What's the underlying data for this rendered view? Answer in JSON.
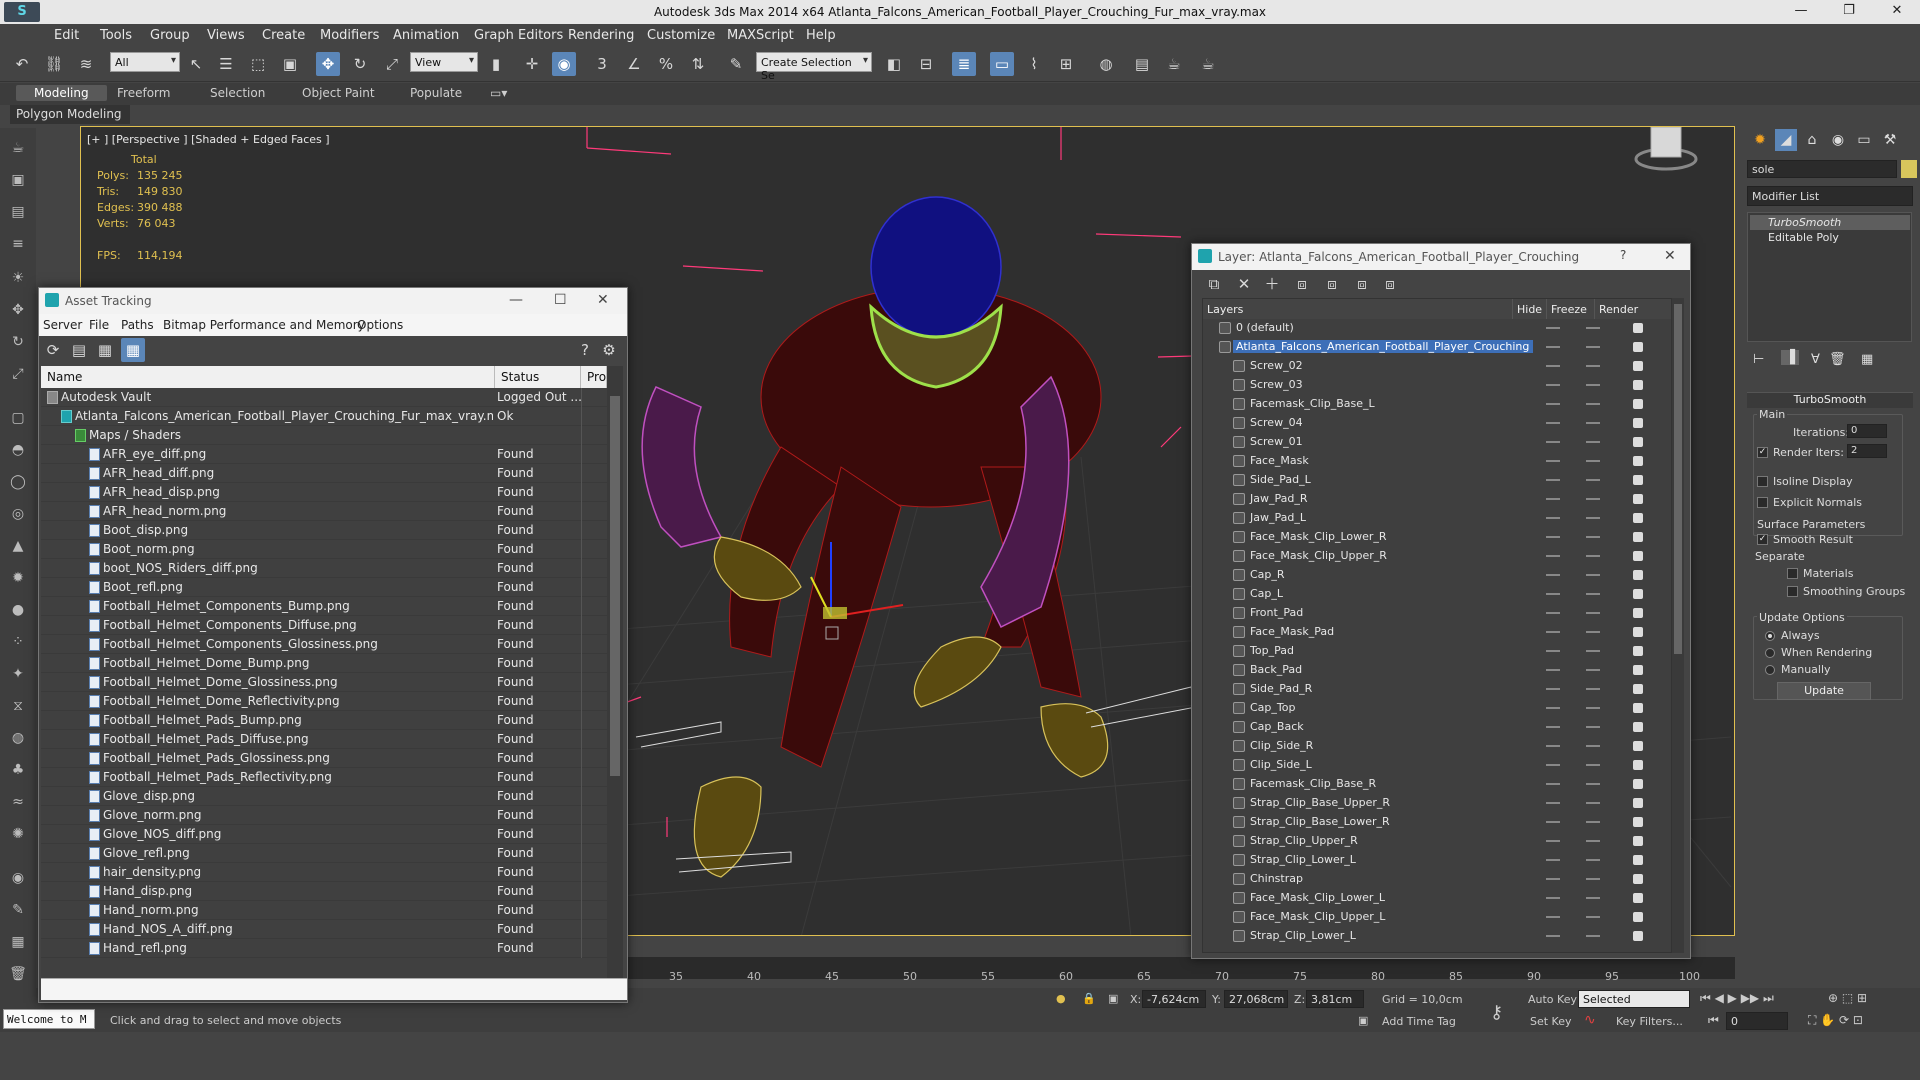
{
  "app": {
    "title": "Autodesk 3ds Max  2014 x64     Atlanta_Falcons_American_Football_Player_Crouching_Fur_max_vray.max",
    "logo": "3ds Max logo"
  },
  "menu": [
    "Edit",
    "Tools",
    "Group",
    "Views",
    "Create",
    "Modifiers",
    "Animation",
    "Graph Editors",
    "Rendering",
    "Customize",
    "MAXScript",
    "Help"
  ],
  "toolbar": {
    "selection_filter": "All",
    "ref_coord": "View",
    "named_selection": "Create Selection Se"
  },
  "ribbon": {
    "tabs": [
      "Modeling",
      "Freeform",
      "Selection",
      "Object Paint",
      "Populate"
    ],
    "active": "Modeling",
    "panel": "Polygon Modeling"
  },
  "viewport": {
    "label": "[+ ] [Perspective ] [Shaded + Edged Faces ]",
    "stats": {
      "header": "Total",
      "polys_label": "Polys:",
      "polys": "135 245",
      "tris_label": "Tris:",
      "tris": "149 830",
      "edges_label": "Edges:",
      "edges": "390 488",
      "verts_label": "Verts:",
      "verts": "76 043",
      "fps_label": "FPS:",
      "fps": "114,194"
    }
  },
  "timeline": {
    "ticks": [
      "35",
      "40",
      "45",
      "50",
      "55",
      "60",
      "65",
      "70",
      "75",
      "80",
      "85",
      "90",
      "95",
      "100"
    ]
  },
  "asset_tracking": {
    "title": "Asset Tracking",
    "menu": [
      "Server",
      "File",
      "Paths",
      "Bitmap Performance and Memory",
      "Options"
    ],
    "columns": [
      "Name",
      "Status",
      "Pro"
    ],
    "rows": [
      {
        "name": "Autodesk Vault",
        "status": "Logged Out ...",
        "level": 0
      },
      {
        "name": "Atlanta_Falcons_American_Football_Player_Crouching_Fur_max_vray.max",
        "status": "Ok",
        "level": 1
      },
      {
        "name": "Maps / Shaders",
        "status": "",
        "level": 2
      },
      {
        "name": "AFR_eye_diff.png",
        "status": "Found",
        "level": 3
      },
      {
        "name": "AFR_head_diff.png",
        "status": "Found",
        "level": 3
      },
      {
        "name": "AFR_head_disp.png",
        "status": "Found",
        "level": 3
      },
      {
        "name": "AFR_head_norm.png",
        "status": "Found",
        "level": 3
      },
      {
        "name": "Boot_disp.png",
        "status": "Found",
        "level": 3
      },
      {
        "name": "Boot_norm.png",
        "status": "Found",
        "level": 3
      },
      {
        "name": "boot_NOS_Riders_diff.png",
        "status": "Found",
        "level": 3
      },
      {
        "name": "Boot_refl.png",
        "status": "Found",
        "level": 3
      },
      {
        "name": "Football_Helmet_Components_Bump.png",
        "status": "Found",
        "level": 3
      },
      {
        "name": "Football_Helmet_Components_Diffuse.png",
        "status": "Found",
        "level": 3
      },
      {
        "name": "Football_Helmet_Components_Glossiness.png",
        "status": "Found",
        "level": 3
      },
      {
        "name": "Football_Helmet_Dome_Bump.png",
        "status": "Found",
        "level": 3
      },
      {
        "name": "Football_Helmet_Dome_Glossiness.png",
        "status": "Found",
        "level": 3
      },
      {
        "name": "Football_Helmet_Dome_Reflectivity.png",
        "status": "Found",
        "level": 3
      },
      {
        "name": "Football_Helmet_Pads_Bump.png",
        "status": "Found",
        "level": 3
      },
      {
        "name": "Football_Helmet_Pads_Diffuse.png",
        "status": "Found",
        "level": 3
      },
      {
        "name": "Football_Helmet_Pads_Glossiness.png",
        "status": "Found",
        "level": 3
      },
      {
        "name": "Football_Helmet_Pads_Reflectivity.png",
        "status": "Found",
        "level": 3
      },
      {
        "name": "Glove_disp.png",
        "status": "Found",
        "level": 3
      },
      {
        "name": "Glove_norm.png",
        "status": "Found",
        "level": 3
      },
      {
        "name": "Glove_NOS_diff.png",
        "status": "Found",
        "level": 3
      },
      {
        "name": "Glove_refl.png",
        "status": "Found",
        "level": 3
      },
      {
        "name": "hair_density.png",
        "status": "Found",
        "level": 3
      },
      {
        "name": "Hand_disp.png",
        "status": "Found",
        "level": 3
      },
      {
        "name": "Hand_norm.png",
        "status": "Found",
        "level": 3
      },
      {
        "name": "Hand_NOS_A_diff.png",
        "status": "Found",
        "level": 3
      },
      {
        "name": "Hand_refl.png",
        "status": "Found",
        "level": 3
      }
    ]
  },
  "layer_window": {
    "title": "Layer: Atlanta_Falcons_American_Football_Player_Crouching",
    "help": "?",
    "columns": [
      "Layers",
      "Hide",
      "Freeze",
      "Render"
    ],
    "layers": [
      {
        "name": "0 (default)",
        "level": 0
      },
      {
        "name": "Atlanta_Falcons_American_Football_Player_Crouching",
        "level": 0,
        "selected": true
      },
      {
        "name": "Screw_02",
        "level": 1
      },
      {
        "name": "Screw_03",
        "level": 1
      },
      {
        "name": "Facemask_Clip_Base_L",
        "level": 1
      },
      {
        "name": "Screw_04",
        "level": 1
      },
      {
        "name": "Screw_01",
        "level": 1
      },
      {
        "name": "Face_Mask",
        "level": 1
      },
      {
        "name": "Side_Pad_L",
        "level": 1
      },
      {
        "name": "Jaw_Pad_R",
        "level": 1
      },
      {
        "name": "Jaw_Pad_L",
        "level": 1
      },
      {
        "name": "Face_Mask_Clip_Lower_R",
        "level": 1
      },
      {
        "name": "Face_Mask_Clip_Upper_R",
        "level": 1
      },
      {
        "name": "Cap_R",
        "level": 1
      },
      {
        "name": "Cap_L",
        "level": 1
      },
      {
        "name": "Front_Pad",
        "level": 1
      },
      {
        "name": "Face_Mask_Pad",
        "level": 1
      },
      {
        "name": "Top_Pad",
        "level": 1
      },
      {
        "name": "Back_Pad",
        "level": 1
      },
      {
        "name": "Side_Pad_R",
        "level": 1
      },
      {
        "name": "Cap_Top",
        "level": 1
      },
      {
        "name": "Cap_Back",
        "level": 1
      },
      {
        "name": "Clip_Side_R",
        "level": 1
      },
      {
        "name": "Clip_Side_L",
        "level": 1
      },
      {
        "name": "Facemask_Clip_Base_R",
        "level": 1
      },
      {
        "name": "Strap_Clip_Base_Upper_R",
        "level": 1
      },
      {
        "name": "Strap_Clip_Base_Lower_R",
        "level": 1
      },
      {
        "name": "Strap_Clip_Upper_R",
        "level": 1
      },
      {
        "name": "Strap_Clip_Lower_L",
        "level": 1
      },
      {
        "name": "Chinstrap",
        "level": 1
      },
      {
        "name": "Face_Mask_Clip_Lower_L",
        "level": 1
      },
      {
        "name": "Face_Mask_Clip_Upper_L",
        "level": 1
      },
      {
        "name": "Strap_Clip_Lower_L",
        "level": 1
      }
    ]
  },
  "command_panel": {
    "object_name": "sole",
    "object_color": "#d8c65c",
    "modifier_list": "Modifier List",
    "stack": [
      "TurboSmooth",
      "Editable Poly"
    ],
    "rollout": "TurboSmooth",
    "main_label": "Main",
    "iterations_label": "Iterations:",
    "iterations": "0",
    "render_iters_label": "Render Iters:",
    "render_iters": "2",
    "isoline": "Isoline Display",
    "explicit_normals": "Explicit Normals",
    "surface_params": "Surface Parameters",
    "smooth_result": "Smooth Result",
    "separate": "Separate",
    "materials": "Materials",
    "smoothing_groups": "Smoothing Groups",
    "update_options": "Update Options",
    "always": "Always",
    "when_rendering": "When Rendering",
    "manually": "Manually",
    "update_btn": "Update"
  },
  "status": {
    "welcome": "Welcome to M",
    "prompt": "Click and drag to select and move objects",
    "x_label": "X:",
    "x": "-7,624cm",
    "y_label": "Y:",
    "y": "27,068cm",
    "z_label": "Z:",
    "z": "3,81cm",
    "grid": "Grid = 10,0cm",
    "add_time_tag": "Add Time Tag",
    "auto_key": "Auto Key",
    "set_key": "Set Key",
    "selected": "Selected",
    "key_filters": "Key Filters...",
    "frame": "0"
  }
}
